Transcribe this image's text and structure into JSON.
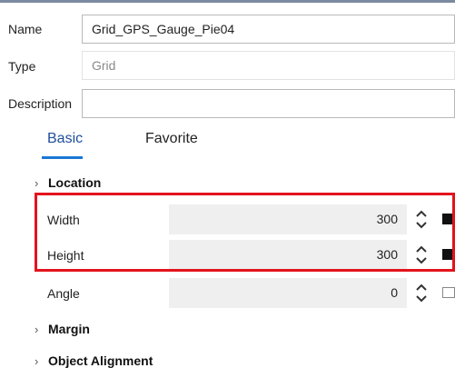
{
  "header": {
    "name_label": "Name",
    "name_value": "Grid_GPS_Gauge_Pie04",
    "type_label": "Type",
    "type_value": "Grid",
    "description_label": "Description",
    "description_value": ""
  },
  "tabs": [
    {
      "label": "Basic",
      "active": true
    },
    {
      "label": "Favorite",
      "active": false
    }
  ],
  "sections": {
    "location": "Location",
    "margin": "Margin",
    "object_alignment": "Object Alignment"
  },
  "properties": [
    {
      "label": "Width",
      "value": "300",
      "swatch": "filled"
    },
    {
      "label": "Height",
      "value": "300",
      "swatch": "filled"
    },
    {
      "label": "Angle",
      "value": "0",
      "swatch": "empty"
    }
  ],
  "icons": {
    "expand": "chevron-right-icon",
    "spin_up": "chevron-up-icon",
    "spin_down": "chevron-down-icon"
  },
  "colors": {
    "highlight": "#e3131c",
    "tab_active": "#1f4e9a",
    "tab_underline": "#1a78d4"
  }
}
